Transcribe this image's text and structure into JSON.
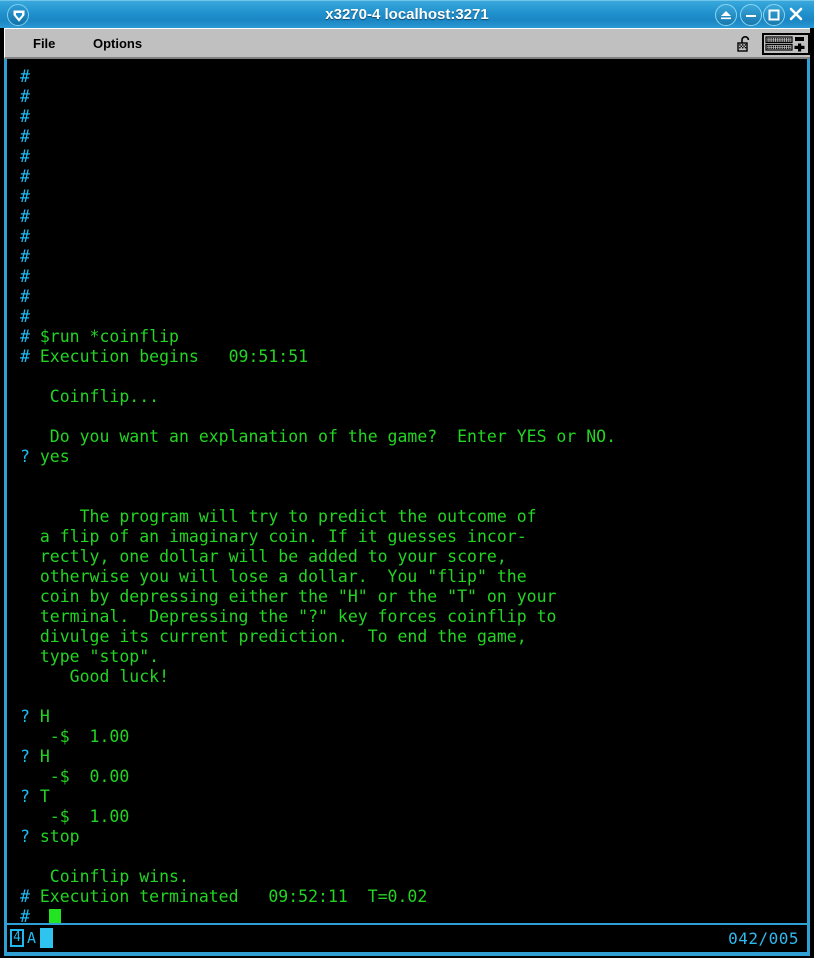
{
  "window": {
    "title": "x3270-4 localhost:3271",
    "menu_orb_icon": "app-menu-icon",
    "buttons": [
      {
        "name": "shade-button",
        "icon": "eject-icon",
        "label": ""
      },
      {
        "name": "minimize-button",
        "icon": "minimize-icon",
        "label": ""
      },
      {
        "name": "maximize-button",
        "icon": "maximize-icon",
        "label": ""
      },
      {
        "name": "close-button",
        "icon": "close-icon",
        "label": ""
      }
    ]
  },
  "menubar": {
    "file_label": "File",
    "options_label": "Options",
    "lock_icon": "unlocked-padlock-icon",
    "keyboard_icon": "keyboard-icon"
  },
  "terminal": {
    "rows": [
      {
        "prompt": "#",
        "text": ""
      },
      {
        "prompt": "#",
        "text": ""
      },
      {
        "prompt": "#",
        "text": ""
      },
      {
        "prompt": "#",
        "text": ""
      },
      {
        "prompt": "#",
        "text": ""
      },
      {
        "prompt": "#",
        "text": ""
      },
      {
        "prompt": "#",
        "text": ""
      },
      {
        "prompt": "#",
        "text": ""
      },
      {
        "prompt": "#",
        "text": ""
      },
      {
        "prompt": "#",
        "text": ""
      },
      {
        "prompt": "#",
        "text": ""
      },
      {
        "prompt": "#",
        "text": ""
      },
      {
        "prompt": "#",
        "text": ""
      },
      {
        "prompt": "#",
        "text": " $run *coinflip"
      },
      {
        "prompt": "#",
        "text": " Execution begins   09:51:51"
      },
      {
        "prompt": " ",
        "text": ""
      },
      {
        "prompt": " ",
        "text": "  Coinflip..."
      },
      {
        "prompt": " ",
        "text": ""
      },
      {
        "prompt": " ",
        "text": "  Do you want an explanation of the game?  Enter YES or NO."
      },
      {
        "prompt": "?",
        "text": " yes"
      },
      {
        "prompt": " ",
        "text": ""
      },
      {
        "prompt": " ",
        "text": ""
      },
      {
        "prompt": " ",
        "text": "     The program will try to predict the outcome of"
      },
      {
        "prompt": " ",
        "text": " a flip of an imaginary coin. If it guesses incor-"
      },
      {
        "prompt": " ",
        "text": " rectly, one dollar will be added to your score,"
      },
      {
        "prompt": " ",
        "text": " otherwise you will lose a dollar.  You \"flip\" the"
      },
      {
        "prompt": " ",
        "text": " coin by depressing either the \"H\" or the \"T\" on your"
      },
      {
        "prompt": " ",
        "text": " terminal.  Depressing the \"?\" key forces coinflip to"
      },
      {
        "prompt": " ",
        "text": " divulge its current prediction.  To end the game,"
      },
      {
        "prompt": " ",
        "text": " type \"stop\"."
      },
      {
        "prompt": " ",
        "text": "    Good luck!"
      },
      {
        "prompt": " ",
        "text": ""
      },
      {
        "prompt": "?",
        "text": " H"
      },
      {
        "prompt": " ",
        "text": "  -$  1.00"
      },
      {
        "prompt": "?",
        "text": " H"
      },
      {
        "prompt": " ",
        "text": "  -$  0.00"
      },
      {
        "prompt": "?",
        "text": " T"
      },
      {
        "prompt": " ",
        "text": "  -$  1.00"
      },
      {
        "prompt": "?",
        "text": " stop"
      },
      {
        "prompt": " ",
        "text": ""
      },
      {
        "prompt": " ",
        "text": "  Coinflip wins."
      },
      {
        "prompt": "#",
        "text": " Execution terminated   09:52:11  T=0.02"
      },
      {
        "prompt": "#",
        "text": ""
      }
    ],
    "field_marker": "3",
    "cursor_visible": true
  },
  "statusbar": {
    "model_number": "4",
    "connection_letter": "A",
    "status_block": "ready-block-indicator",
    "cursor_position": "042/005"
  },
  "colors": {
    "prompt": "#1fb9f0",
    "text": "#23d423",
    "marker": "#f2f2f2",
    "frame": "#2f9fd4",
    "titlebar": "#1f8fcc",
    "menubar": "#c0c0c0",
    "screen_bg": "#000000"
  }
}
